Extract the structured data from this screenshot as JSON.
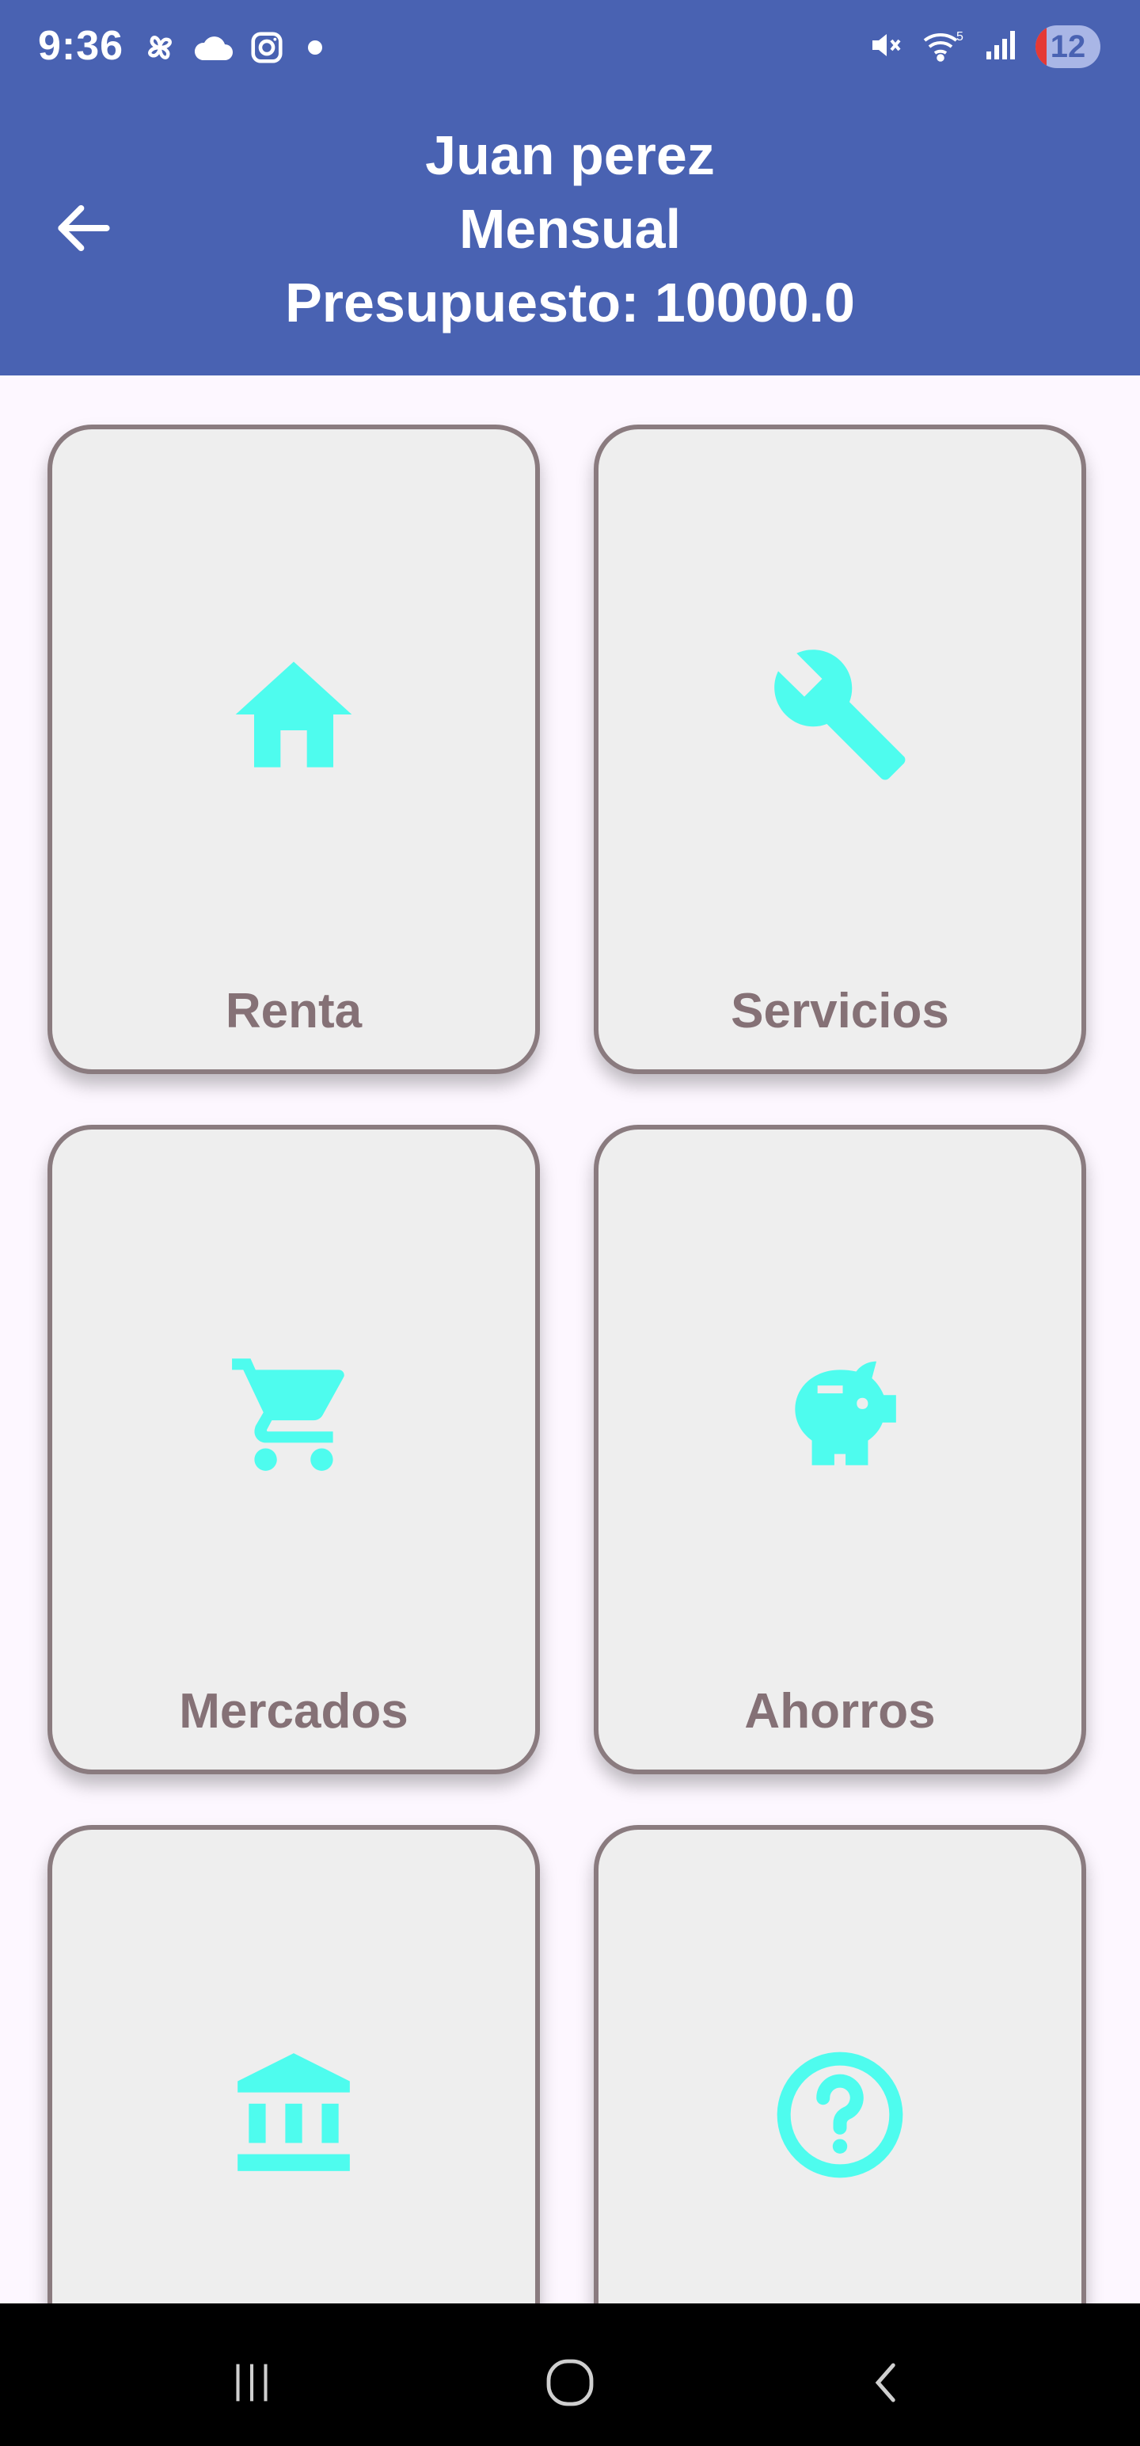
{
  "status_bar": {
    "time": "9:36",
    "battery_level": "12",
    "left_icons": [
      "pinwheel-icon",
      "cloud-icon",
      "instagram-icon",
      "dot-icon"
    ],
    "right_icons": [
      "mute-icon",
      "wifi-5-icon",
      "signal-icon",
      "battery-icon"
    ]
  },
  "header": {
    "name": "Juan perez",
    "period": "Mensual",
    "budget": "Presupuesto: 10000.0",
    "back_icon": "arrow-back-icon"
  },
  "categories": [
    {
      "label": "Renta",
      "icon": "home-icon"
    },
    {
      "label": "Servicios",
      "icon": "wrench-icon"
    },
    {
      "label": "Mercados",
      "icon": "shopping-cart-icon"
    },
    {
      "label": "Ahorros",
      "icon": "piggy-bank-icon"
    },
    {
      "label": "",
      "icon": "bank-icon"
    },
    {
      "label": "",
      "icon": "help-circle-icon"
    }
  ],
  "colors": {
    "appbar": "#4962b2",
    "card_bg": "#eeeeee",
    "card_border": "#8a7b7f",
    "icon_accent": "#4efcee",
    "label_text": "#857176",
    "page_bg": "#fdf7ff"
  },
  "navigation_bar": [
    "recent-apps-icon",
    "home-circle-icon",
    "back-chevron-icon"
  ]
}
